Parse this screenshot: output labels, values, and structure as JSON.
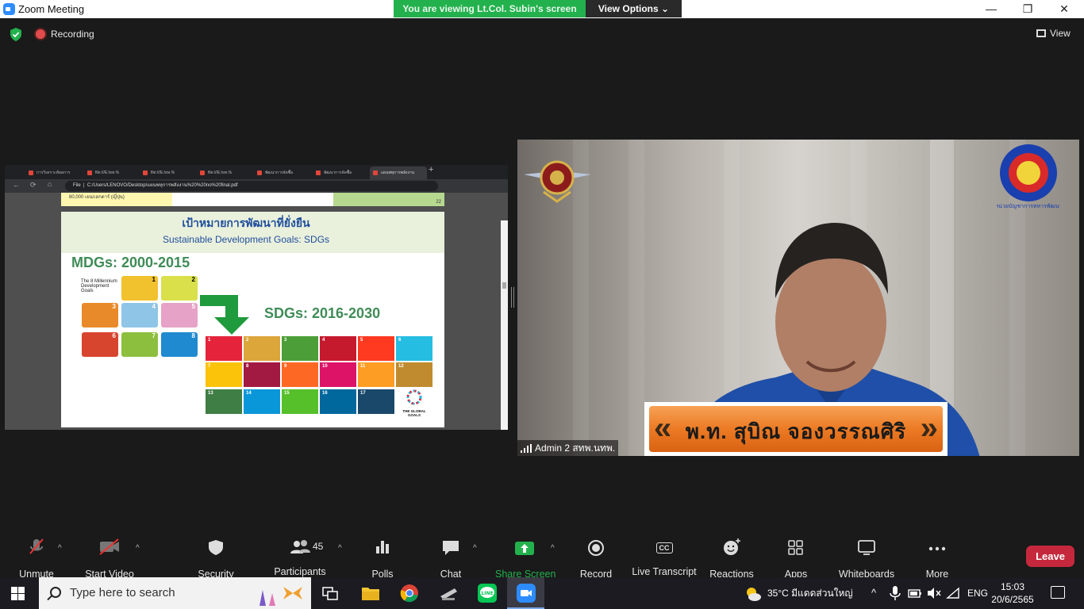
{
  "window": {
    "title": "Zoom Meeting",
    "controls": {
      "minimize": "—",
      "restore": "❐",
      "close": "✕"
    }
  },
  "banner": {
    "viewing_text": "You are viewing Lt.Col. Subin's screen",
    "view_options_label": "View Options",
    "view_options_caret": "⌄"
  },
  "meeting_bar": {
    "recording_label": "Recording",
    "view_label": "View"
  },
  "shared_screen": {
    "browser_tabs": [
      "การวิเคราะห์ผลการ",
      "file:///E:/ยท.%",
      "file:///E:/ยท.%",
      "file:///E:/ยท.%",
      "พัฒนาการจัดซื้อ",
      "พัฒนาการจัดซื้อ",
      "แผนพหุการพลังงาน"
    ],
    "new_tab": "+",
    "address_prefix": "File",
    "address_url": "C:/Users/LENOVO/Desktop/แผนพหุการพลังงาน%20%20no%20final.pdf",
    "prev_page_text": "80,000 เยน/เฮกตาร์ (ญี่ปุ่น)",
    "prev_page_number": "22",
    "slide": {
      "title_th": "เป้าหมายการพัฒนาที่ยั่งยืน",
      "title_en": "Sustainable Development Goals: SDGs",
      "mdgs_title": "MDGs: 2000-2015",
      "mdg_caption": "The 8 Millennium Development Goals",
      "mdg_numbers": [
        "1",
        "2",
        "3",
        "4",
        "5",
        "6",
        "7",
        "8"
      ],
      "sdgs_title": "SDGs: 2016-2030",
      "sdg_numbers": [
        "1",
        "2",
        "3",
        "4",
        "5",
        "6",
        "7",
        "8",
        "9",
        "10",
        "11",
        "12",
        "13",
        "14",
        "15",
        "16",
        "17"
      ],
      "global_goals_label": "THE GLOBAL GOALS"
    }
  },
  "video": {
    "participant_label": "Admin 2 สทพ.นทพ.",
    "nameplate_text": "พ.ท. สุบิณ  จองวรรณศิริ"
  },
  "toolbar": {
    "unmute": "Unmute",
    "start_video": "Start Video",
    "security": "Security",
    "participants": "Participants",
    "participants_count": "45",
    "polls": "Polls",
    "chat": "Chat",
    "share_screen": "Share Screen",
    "record": "Record",
    "live_transcript": "Live Transcript",
    "cc_badge": "CC",
    "reactions": "Reactions",
    "apps": "Apps",
    "whiteboards": "Whiteboards",
    "more": "More",
    "leave": "Leave",
    "caret": "^"
  },
  "taskbar": {
    "search_placeholder": "Type here to search",
    "weather": "35°C มีแดดส่วนใหญ่",
    "tray_caret": "^",
    "language": "ENG",
    "time": "15:03",
    "date": "20/6/2565"
  },
  "colors": {
    "banner_green": "#23b14d",
    "leave_red": "#c5283d",
    "share_green": "#23b14d",
    "slide_title_blue": "#1f4e9c",
    "slide_green": "#3f8c57"
  }
}
